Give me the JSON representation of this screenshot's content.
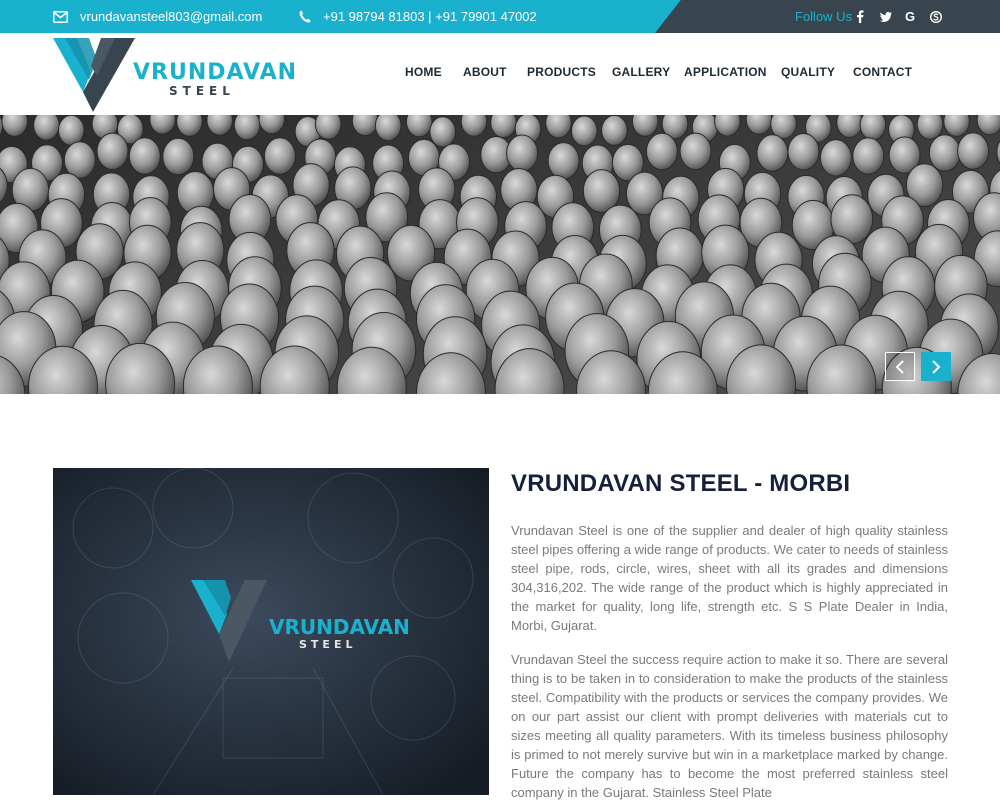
{
  "topbar": {
    "email": "vrundavansteel803@gmail.com",
    "phone": "+91 98794 81803 | +91 79901 47002",
    "follow_label": "Follow Us",
    "social_icons": [
      "facebook-icon",
      "twitter-icon",
      "google-icon",
      "skype-icon"
    ],
    "social_glyphs": [
      "f",
      "t",
      "G",
      "S"
    ]
  },
  "brand": {
    "name": "VRUNDAVAN",
    "sub": "STEEL",
    "logo_colors": {
      "cyan": "#1ab1cf",
      "dark": "#38454e"
    }
  },
  "nav": {
    "items": [
      "HOME",
      "ABOUT",
      "PRODUCTS",
      "GALLERY",
      "APPLICATION",
      "QUALITY",
      "CONTACT"
    ]
  },
  "about": {
    "title": "VRUNDAVAN STEEL - MORBI",
    "paragraph_1": "Vrundavan Steel is one of the supplier and dealer of high quality stainless steel pipes offering a wide range of products. We cater to needs of stainless steel pipe, rods, circle, wires, sheet with all its grades and dimensions 304,316,202. The wide range of the product which is highly appreciated in the market for quality, long life, strength etc. S S Plate Dealer in India, Morbi, Gujarat.",
    "paragraph_2": "Vrundavan Steel the success require action to make it so. There are several thing is to be taken in to consideration to make the products of the stainless steel. Compatibility with the products or services the company provides. We on our part assist our client with prompt deliveries with materials cut to sizes meeting all quality parameters. With its timeless business philosophy is primed to not merely survive but win in a marketplace marked by change. Future the company has to become the most preferred stainless steel company in the Gujarat. Stainless Steel Plate"
  },
  "colors": {
    "accent": "#1ab1cf",
    "dark": "#38454e",
    "title": "#15203a",
    "body_text": "#7a7a7a"
  }
}
